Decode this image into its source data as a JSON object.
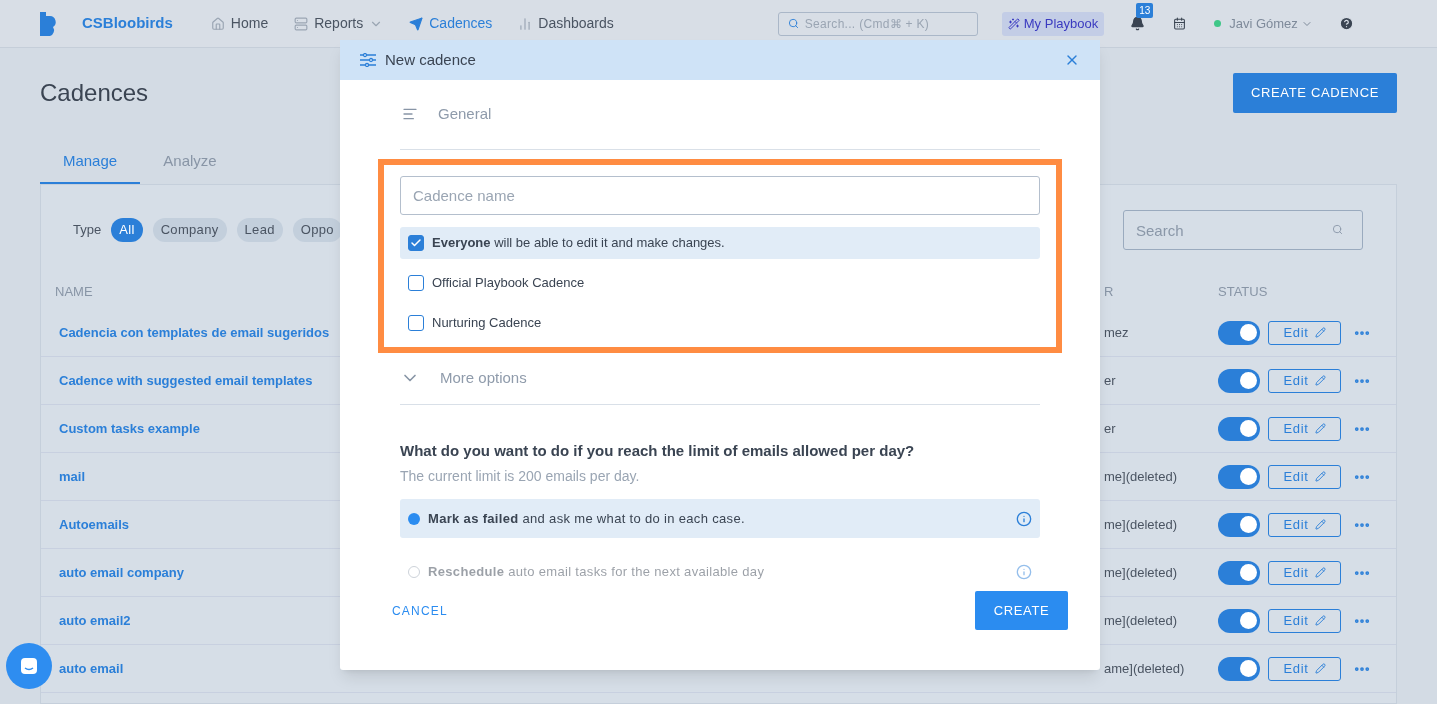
{
  "nav": {
    "brand": "CSBloobirds",
    "items": [
      {
        "label": "Home",
        "selected": false,
        "dropdown": false
      },
      {
        "label": "Reports",
        "selected": false,
        "dropdown": true
      },
      {
        "label": "Cadences",
        "selected": true,
        "dropdown": false
      },
      {
        "label": "Dashboards",
        "selected": false,
        "dropdown": false
      }
    ],
    "search": {
      "placeholder": "Search... (Cmd⌘ + K)"
    },
    "playbook": "My Playbook",
    "notifications": "13",
    "user": "Javi Gómez"
  },
  "page": {
    "title": "Cadences",
    "create_button": "CREATE CADENCE",
    "tabs": [
      {
        "label": "Manage",
        "selected": true
      },
      {
        "label": "Analyze",
        "selected": false
      }
    ]
  },
  "filters": {
    "label": "Type",
    "chips": [
      {
        "label": "All",
        "selected": true
      },
      {
        "label": "Company",
        "selected": false
      },
      {
        "label": "Lead",
        "selected": false
      },
      {
        "label": "Oppo",
        "selected": false
      }
    ]
  },
  "search": {
    "placeholder": "Search"
  },
  "table": {
    "columns": [
      "NAME",
      "R",
      "STATUS"
    ],
    "rows": [
      {
        "name": "Cadencia con templates de email sugeridos",
        "owner": "mez",
        "on": true,
        "action": "Edit"
      },
      {
        "name": "Cadence with suggested email templates",
        "owner": "er",
        "on": true,
        "action": "Edit"
      },
      {
        "name": "Custom tasks example",
        "owner": "er",
        "on": true,
        "action": "Edit"
      },
      {
        "name": "mail",
        "owner": "me](deleted)",
        "on": true,
        "action": "Edit"
      },
      {
        "name": "Autoemails",
        "owner": "me](deleted)",
        "on": true,
        "action": "Edit"
      },
      {
        "name": "auto email company",
        "owner": "me](deleted)",
        "on": true,
        "action": "Edit"
      },
      {
        "name": "auto email2",
        "owner": "me](deleted)",
        "on": true,
        "action": "Edit"
      },
      {
        "name": "auto email",
        "owner": "ame](deleted)",
        "on": true,
        "action": "Edit"
      }
    ]
  },
  "modal": {
    "title": "New cadence",
    "section": "General",
    "name_field": {
      "placeholder": "Cadence name"
    },
    "options": [
      {
        "text": "**Everyone** will be able to edit it and make changes.",
        "checked": true
      },
      {
        "text": "Official Playbook Cadence",
        "checked": false
      },
      {
        "text": "Nurturing Cadence",
        "checked": false
      }
    ],
    "more_options": {
      "label": "More options",
      "expanded": false
    },
    "question": "What do you want to do if you reach the limit of emails allowed per day?",
    "hint": "The current limit is 200 emails per day.",
    "choices": [
      {
        "text": "**Mark as failed** and ask me what to do in each case.",
        "selected": true
      },
      {
        "text": "**Reschedule** auto email tasks for the next available day",
        "selected": false
      }
    ],
    "cancel": "CANCEL",
    "create": "CREATE"
  }
}
